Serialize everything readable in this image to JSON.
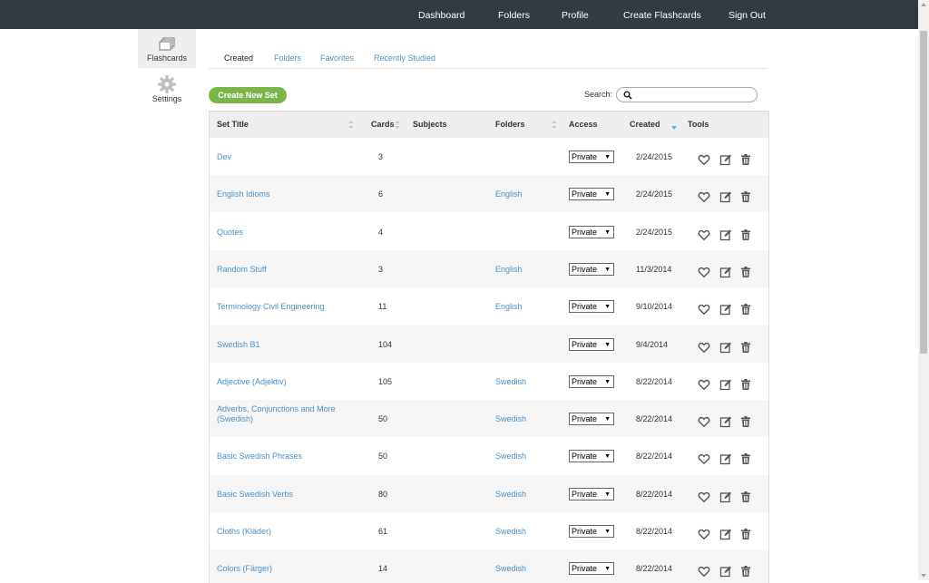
{
  "nav": {
    "items": [
      {
        "label": "Dashboard"
      },
      {
        "label": "Folders"
      },
      {
        "label": "Profile"
      },
      {
        "label": "Create Flashcards"
      },
      {
        "label": "Sign Out"
      }
    ]
  },
  "sidebar": {
    "items": [
      {
        "label": "Flashcards",
        "icon": "flashcards-icon",
        "active": true
      },
      {
        "label": "Settings",
        "icon": "gear-icon",
        "active": false
      }
    ]
  },
  "tabs": [
    {
      "label": "Created",
      "active": true
    },
    {
      "label": "Folders",
      "active": false
    },
    {
      "label": "Favorites",
      "active": false
    },
    {
      "label": "Recently Studied",
      "active": false
    }
  ],
  "toolbar": {
    "create_label": "Create New Set",
    "search_label": "Search:",
    "search_value": ""
  },
  "table": {
    "columns": [
      "Set Title",
      "Cards",
      "Subjects",
      "Folders",
      "Access",
      "Created",
      "Tools"
    ],
    "rows": [
      {
        "title": "Dev",
        "cards": "3",
        "subjects": "",
        "folder": "",
        "access": "Private",
        "created": "2/24/2015"
      },
      {
        "title": "English Idioms",
        "cards": "6",
        "subjects": "",
        "folder": "English",
        "access": "Private",
        "created": "2/24/2015"
      },
      {
        "title": "Quotes",
        "cards": "4",
        "subjects": "",
        "folder": "",
        "access": "Private",
        "created": "2/24/2015"
      },
      {
        "title": "Random Stuff",
        "cards": "3",
        "subjects": "",
        "folder": "English",
        "access": "Private",
        "created": "11/3/2014"
      },
      {
        "title": "Terminology Civil Engineering",
        "cards": "11",
        "subjects": "",
        "folder": "English",
        "access": "Private",
        "created": "9/10/2014"
      },
      {
        "title": "Swedish B1",
        "cards": "104",
        "subjects": "",
        "folder": "",
        "access": "Private",
        "created": "9/4/2014"
      },
      {
        "title": "Adjective (Adjektiv)",
        "cards": "105",
        "subjects": "",
        "folder": "Swedish",
        "access": "Private",
        "created": "8/22/2014"
      },
      {
        "title": "Adverbs, Conjunctions and More (Swedish)",
        "cards": "50",
        "subjects": "",
        "folder": "Swedish",
        "access": "Private",
        "created": "8/22/2014"
      },
      {
        "title": "Basic Swedish Phrases",
        "cards": "50",
        "subjects": "",
        "folder": "Swedish",
        "access": "Private",
        "created": "8/22/2014"
      },
      {
        "title": "Basic Swedish Verbs",
        "cards": "80",
        "subjects": "",
        "folder": "Swedish",
        "access": "Private",
        "created": "8/22/2014"
      },
      {
        "title": "Cloths (Kläder)",
        "cards": "61",
        "subjects": "",
        "folder": "Swedish",
        "access": "Private",
        "created": "8/22/2014"
      },
      {
        "title": "Colors (Färger)",
        "cards": "14",
        "subjects": "",
        "folder": "Swedish",
        "access": "Private",
        "created": "8/22/2014"
      }
    ]
  },
  "colors": {
    "topbar": "#343b40",
    "accent_link": "#4a90c8",
    "create_button": "#7ab648",
    "sort_active": "#5aaedc"
  },
  "icons": {
    "favorite": "heart-icon",
    "edit": "edit-icon",
    "delete": "trash-icon",
    "search": "search-icon"
  }
}
